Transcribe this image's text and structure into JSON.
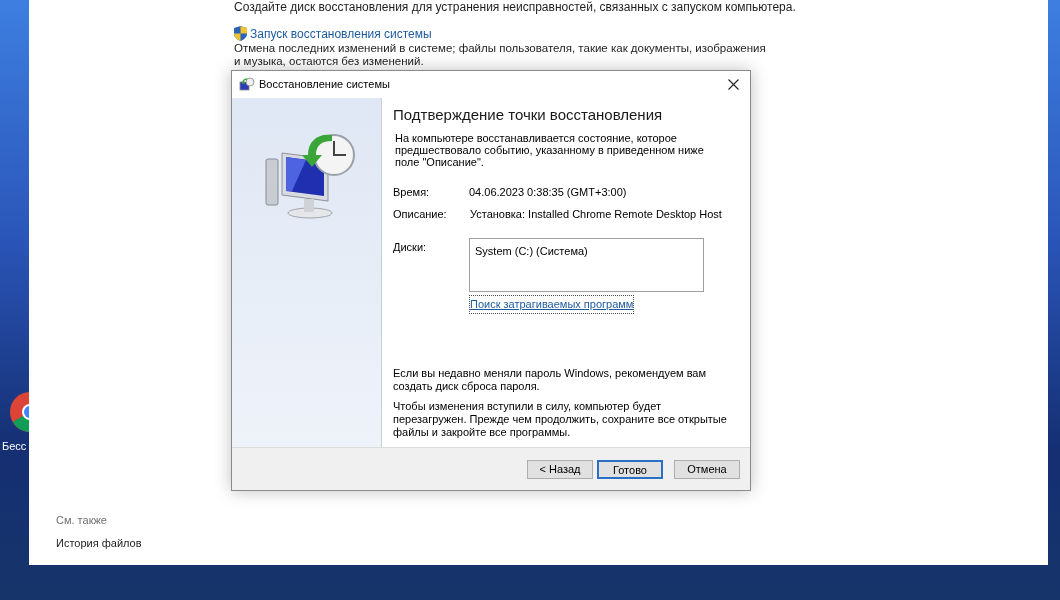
{
  "desktop": {
    "icons": [
      {
        "label": "Бесс"
      }
    ]
  },
  "control_panel": {
    "intro": "Создайте диск восстановления для устранения неисправностей, связанных с запуском компьютера.",
    "link": "Запуск восстановления системы",
    "link_description": "Отмена последних изменений в системе; файлы пользователя, такие как документы, изображения и музыка, остаются без изменений.",
    "see_also": {
      "heading": "См. также",
      "items": [
        "История файлов"
      ]
    }
  },
  "dialog": {
    "title": "Восстановление системы",
    "heading": "Подтверждение точки восстановления",
    "description": "На компьютере восстанавливается состояние, которое предшествовало событию, указанному в приведенном ниже поле \"Описание\".",
    "fields": [
      {
        "label": "Время:",
        "value": "04.06.2023 0:38:35 (GMT+3:00)"
      },
      {
        "label": "Описание:",
        "value": "Установка: Installed Chrome Remote Desktop Host"
      }
    ],
    "drives": {
      "label": "Диски:",
      "items": [
        "System (C:) (Система)"
      ]
    },
    "affected_link": "Поиск затрагиваемых программ",
    "notes": [
      "Если вы недавно меняли пароль Windows, рекомендуем вам создать диск сброса пароля.",
      "Чтобы изменения вступили в силу, компьютер будет перезагружен. Прежде чем продолжить, сохраните все открытые файлы и закройте все программы."
    ],
    "buttons": [
      {
        "label": "< Назад",
        "focused": false
      },
      {
        "label": "Готово",
        "focused": true
      },
      {
        "label": "Отмена",
        "focused": false
      }
    ]
  }
}
